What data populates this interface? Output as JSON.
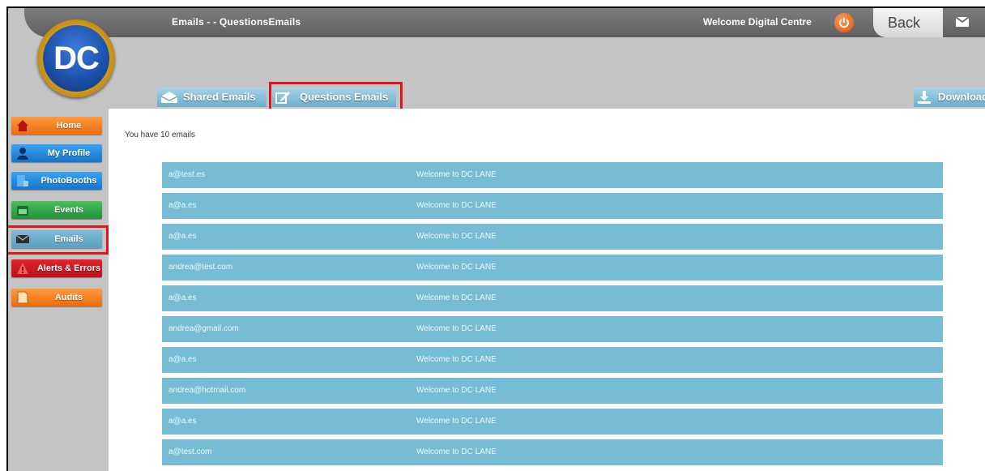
{
  "header": {
    "title": "Emails - - QuestionsEmails",
    "welcome": "Welcome Digital Centre",
    "back_label": "Back"
  },
  "logo": {
    "text": "DC"
  },
  "tabs": [
    {
      "label": "Shared Emails",
      "icon": "envelope-open-icon"
    },
    {
      "label": "Questions Emails",
      "icon": "edit-icon",
      "highlighted": true
    },
    {
      "label": "Download",
      "icon": "download-icon"
    }
  ],
  "sidebar": {
    "items": [
      {
        "label": "Home",
        "icon": "home-icon",
        "color": "#f07d1d"
      },
      {
        "label": "My Profile",
        "icon": "user-icon",
        "color": "#1f86d8"
      },
      {
        "label": "PhotoBooths",
        "icon": "photobooth-icon",
        "color": "#1f86d8"
      },
      {
        "label": "Events",
        "icon": "calendar-icon",
        "color": "#2fa447"
      },
      {
        "label": "Emails",
        "icon": "envelope-icon",
        "color": "#6aaecb",
        "active": true
      },
      {
        "label": "Alerts & Errors",
        "icon": "warning-icon",
        "color": "#c8151d"
      },
      {
        "label": "Audits",
        "icon": "document-icon",
        "color": "#f07d1d"
      }
    ]
  },
  "main": {
    "count_text": "You have 10 emails",
    "rows": [
      {
        "email": "a@test.es",
        "subject": "Welcome to DC LANE"
      },
      {
        "email": "a@a.es",
        "subject": "Welcome to DC LANE"
      },
      {
        "email": "a@a.es",
        "subject": "Welcome to DC LANE"
      },
      {
        "email": "andrea@test.com",
        "subject": "Welcome to DC LANE"
      },
      {
        "email": "a@a.es",
        "subject": "Welcome to DC LANE"
      },
      {
        "email": "andrea@gmail.com",
        "subject": "Welcome to DC LANE"
      },
      {
        "email": "a@a.es",
        "subject": "Welcome to DC LANE"
      },
      {
        "email": "andrea@hotmail.com",
        "subject": "Welcome to DC LANE"
      },
      {
        "email": "a@a.es",
        "subject": "Welcome to DC LANE"
      },
      {
        "email": "a@test.com",
        "subject": "Welcome to DC LANE"
      }
    ]
  },
  "colors": {
    "accent_blue": "#75bcd4",
    "highlight_red": "#e0141e",
    "topbar": "#6b6b6b"
  }
}
